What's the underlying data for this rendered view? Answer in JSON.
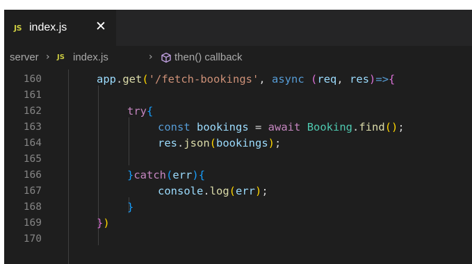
{
  "tab": {
    "file_icon": "JS",
    "file_name": "index.js",
    "close_glyph": "✕"
  },
  "breadcrumb": {
    "folder": "server",
    "sep": "›",
    "file_icon": "JS",
    "file": "index.js",
    "symbol_icon": "cube-icon",
    "symbol": "then() callback"
  },
  "editor": {
    "line_numbers": [
      "160",
      "161",
      "162",
      "163",
      "164",
      "165",
      "166",
      "167",
      "168",
      "169",
      "170"
    ],
    "lines": [
      [
        {
          "t": "app",
          "c": "var"
        },
        {
          "t": ".",
          "c": "plain"
        },
        {
          "t": "get",
          "c": "fn"
        },
        {
          "t": "(",
          "c": "br1"
        },
        {
          "t": "'/fetch-bookings'",
          "c": "str"
        },
        {
          "t": ", ",
          "c": "plain"
        },
        {
          "t": "async",
          "c": "kw"
        },
        {
          "t": " ",
          "c": "plain"
        },
        {
          "t": "(",
          "c": "br2"
        },
        {
          "t": "req",
          "c": "var"
        },
        {
          "t": ", ",
          "c": "plain"
        },
        {
          "t": "res",
          "c": "var"
        },
        {
          "t": ")",
          "c": "br2"
        },
        {
          "t": "=>",
          "c": "kw"
        },
        {
          "t": "{",
          "c": "br2"
        }
      ],
      [],
      [
        {
          "t": "try",
          "c": "ctl"
        },
        {
          "t": "{",
          "c": "br3"
        }
      ],
      [
        {
          "t": "const",
          "c": "kw"
        },
        {
          "t": " ",
          "c": "plain"
        },
        {
          "t": "bookings",
          "c": "var"
        },
        {
          "t": " = ",
          "c": "plain"
        },
        {
          "t": "await",
          "c": "ctl"
        },
        {
          "t": " ",
          "c": "plain"
        },
        {
          "t": "Booking",
          "c": "cls"
        },
        {
          "t": ".",
          "c": "plain"
        },
        {
          "t": "find",
          "c": "fn"
        },
        {
          "t": "()",
          "c": "br1"
        },
        {
          "t": ";",
          "c": "plain"
        }
      ],
      [
        {
          "t": "res",
          "c": "var"
        },
        {
          "t": ".",
          "c": "plain"
        },
        {
          "t": "json",
          "c": "fn"
        },
        {
          "t": "(",
          "c": "br1"
        },
        {
          "t": "bookings",
          "c": "var"
        },
        {
          "t": ")",
          "c": "br1"
        },
        {
          "t": ";",
          "c": "plain"
        }
      ],
      [],
      [
        {
          "t": "}",
          "c": "br3"
        },
        {
          "t": "catch",
          "c": "ctl"
        },
        {
          "t": "(",
          "c": "br3"
        },
        {
          "t": "err",
          "c": "var"
        },
        {
          "t": ")",
          "c": "br3"
        },
        {
          "t": "{",
          "c": "br3"
        }
      ],
      [
        {
          "t": "console",
          "c": "var"
        },
        {
          "t": ".",
          "c": "plain"
        },
        {
          "t": "log",
          "c": "fn"
        },
        {
          "t": "(",
          "c": "br1"
        },
        {
          "t": "err",
          "c": "var"
        },
        {
          "t": ")",
          "c": "br1"
        },
        {
          "t": ";",
          "c": "plain"
        }
      ],
      [
        {
          "t": "}",
          "c": "br3"
        }
      ],
      [
        {
          "t": "}",
          "c": "br2"
        },
        {
          "t": ")",
          "c": "br1"
        }
      ],
      []
    ]
  },
  "colors": {
    "editor_bg": "#1e1e1e",
    "tabbar_bg": "#252526",
    "keyword": "#569cd6",
    "control": "#c586c0",
    "function": "#dcdcaa",
    "string": "#ce9178",
    "variable": "#9cdcfe",
    "class": "#4ec9b0",
    "line_number": "#858585"
  }
}
